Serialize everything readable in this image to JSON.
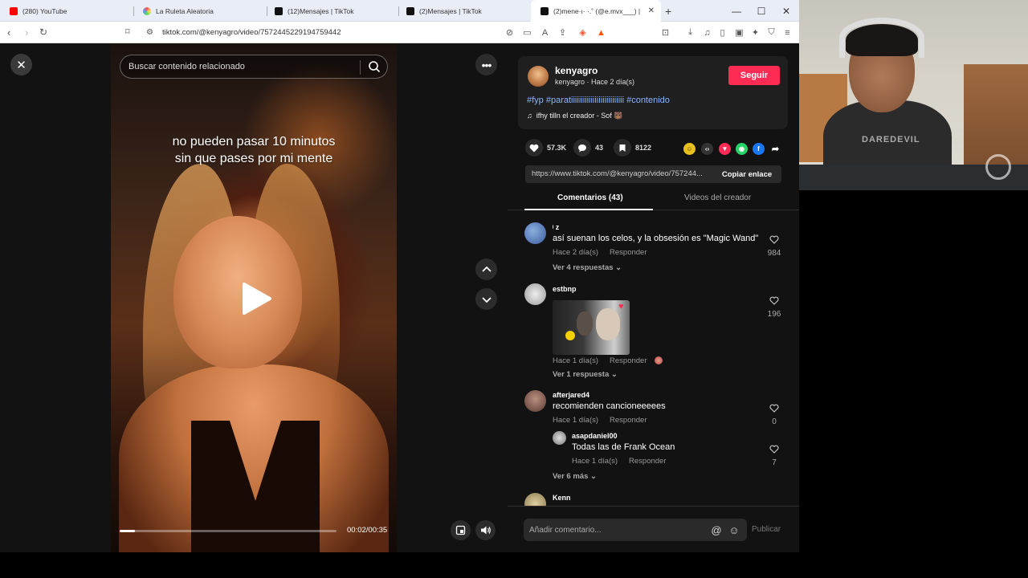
{
  "browser": {
    "tabs": [
      {
        "label": "(280) YouTube",
        "color": "#ff0000",
        "active": false
      },
      {
        "label": "La Ruleta Aleatoria",
        "color": "#8a6cf0",
        "active": false
      },
      {
        "label": "(12)Mensajes | TikTok",
        "color": "#111111",
        "active": false
      },
      {
        "label": "(2)Mensajes | TikTok",
        "color": "#111111",
        "active": false
      },
      {
        "label": "(2)mene·ı· ·.˚ (@e.mvx___) | T",
        "color": "#111111",
        "active": true
      }
    ],
    "url": "tiktok.com/@kenyagro/video/7572445229194759442"
  },
  "video": {
    "search_placeholder": "Buscar contenido relacionado",
    "overlay_line1": "no pueden pasar 10 minutos",
    "overlay_line2": "sin que pases por mi mente",
    "time": "00:02/00:35",
    "progress": 0.07
  },
  "post": {
    "author": "kenyagro",
    "author_sub": "kenyagro · Hace 2 día(s)",
    "follow_label": "Seguir",
    "hashtags": "#fyp #paratiiiiiiiiiiiiiiiiiiiiiiiiiii #contenido",
    "music": "ifhy tilln el creador - Sof 🐻",
    "likes": "57.3K",
    "comments": "43",
    "saves": "8122",
    "link": "https://www.tiktok.com/@kenyagro/video/757244...",
    "copy_label": "Copiar enlace",
    "accent": "#fe2c55"
  },
  "panel_tabs": {
    "comments": "Comentarios (43)",
    "creator_videos": "Videos del creador"
  },
  "comments": [
    {
      "user": "ᵎ z",
      "text": "así suenan los celos, y la obsesión es \"Magic Wand\"",
      "time": "Hace 2 día(s)",
      "reply": "Responder",
      "likes": "984",
      "more": "Ver 4 respuestas"
    },
    {
      "user": "estbnp",
      "text": "",
      "time": "Hace 1 día(s)",
      "reply": "Responder",
      "likes": "196",
      "more": "Ver 1 respuesta"
    },
    {
      "user": "afterjared4",
      "text": "recomienden cancioneeeees",
      "time": "Hace 1 día(s)",
      "reply": "Responder",
      "likes": "0",
      "more": ""
    },
    {
      "user": "asapdaniel00",
      "text": "Todas las de Frank Ocean",
      "time": "Hace 1 día(s)",
      "reply": "Responder",
      "likes": "7",
      "more": "Ver 6 más"
    },
    {
      "user": "Kenn",
      "text": "",
      "time": "",
      "reply": "",
      "likes": "",
      "more": ""
    }
  ],
  "comment_bar": {
    "placeholder": "Añadir comentario...",
    "post_label": "Publicar"
  },
  "webcam": {
    "shirt_text": "DAREDEVIL"
  }
}
